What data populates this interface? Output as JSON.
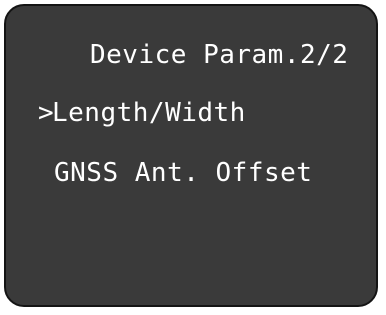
{
  "screen": {
    "title": "Device Param.2/2",
    "cursor": ">",
    "menu": [
      {
        "label": "Length/Width",
        "selected": true
      },
      {
        "label": "GNSS Ant. Offset",
        "selected": false
      }
    ]
  },
  "colors": {
    "background": "#3a3a3a",
    "bezel": "#141414",
    "text": "#ffffff"
  }
}
